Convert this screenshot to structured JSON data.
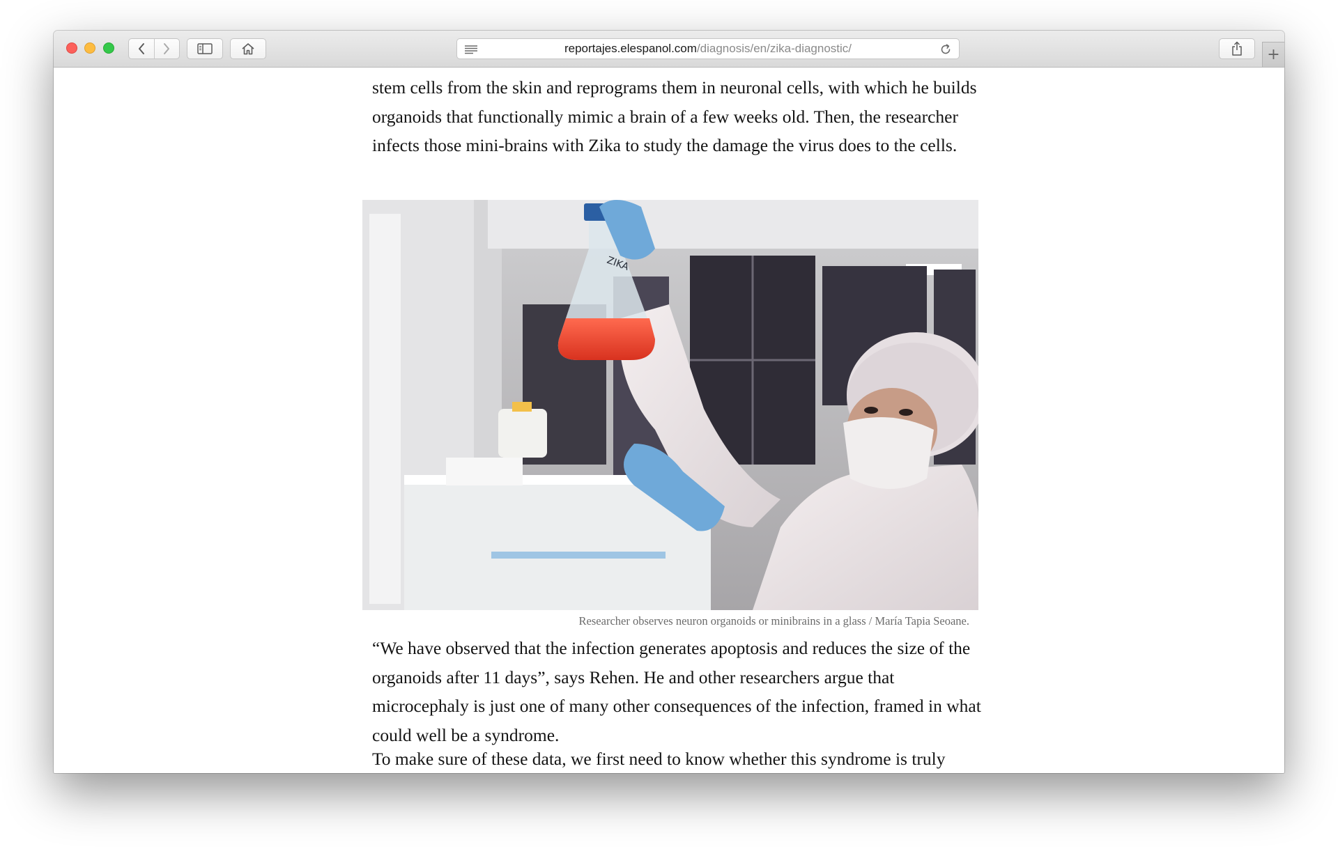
{
  "browser": {
    "url_host": "reportajes.elespanol.com",
    "url_path": "/diagnosis/en/zika-diagnostic/",
    "new_tab_label": "+"
  },
  "article": {
    "paragraph_before": "stem cells from the skin and reprograms them in neuronal cells, with which he builds organoids that functionally mimic a brain of a few weeks old. Then, the researcher infects those mini-brains with Zika to study the damage the virus does to the cells.",
    "figure": {
      "caption": "Researcher observes neuron organoids or minibrains in a glass / María Tapia Seoane.",
      "flask_label": "ZIKA"
    },
    "paragraph_after": "“We have observed that the infection generates apoptosis and reduces the size of the organoids after 11 days”, says Rehen. He and other researchers argue that microcephaly is just one of many other consequences of the infection, framed in what could well be a syndrome.",
    "paragraph_partial": "To make sure of these data, we first need to know whether this syndrome is truly"
  },
  "colors": {
    "close": "#fc605b",
    "minimize": "#fdbc40",
    "maximize": "#34c84a",
    "flask_liquid": "#e8412c",
    "glove": "#6fa9d9"
  },
  "icons": [
    "back-chevron-icon",
    "forward-chevron-icon",
    "sidebar-icon",
    "home-icon",
    "reader-icon",
    "reload-icon",
    "share-icon",
    "plus-icon"
  ]
}
